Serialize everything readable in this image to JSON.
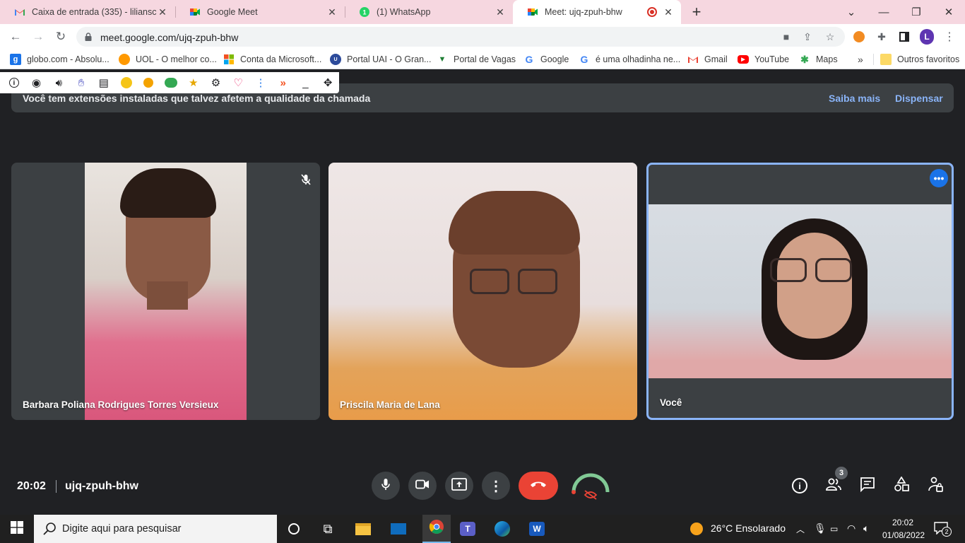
{
  "browser": {
    "tabs": [
      {
        "title": "Caixa de entrada (335) - lilianscar",
        "icon": "gmail-icon"
      },
      {
        "title": "Google Meet",
        "icon": "meet-icon"
      },
      {
        "title": "(1) WhatsApp",
        "icon": "whatsapp-icon"
      },
      {
        "title": "Meet: ujq-zpuh-bhw",
        "icon": "meet-icon",
        "active": true
      }
    ],
    "url": "meet.google.com/ujq-zpuh-bhw",
    "profile_initial": "L",
    "bookmarks": [
      "globo.com - Absolu...",
      "UOL - O melhor co...",
      "Conta da Microsoft...",
      "Portal UAI - O Gran...",
      "Portal de Vagas",
      "Google",
      "é uma olhadinha ne...",
      "Gmail",
      "YouTube",
      "Maps"
    ],
    "bookmarks_overflow": "»",
    "other_favorites": "Outros favoritos"
  },
  "meet": {
    "banner": {
      "message": "Você tem extensões instaladas que talvez afetem a qualidade da chamada",
      "learn_more": "Saiba mais",
      "dismiss": "Dispensar"
    },
    "participants": [
      {
        "name": "Barbara Poliana Rodrigues Torres Versieux",
        "muted": true
      },
      {
        "name": "Priscila Maria de Lana",
        "muted": false
      },
      {
        "name": "Você",
        "muted": false,
        "self": true
      }
    ],
    "time": "20:02",
    "meeting_code": "ujq-zpuh-bhw",
    "people_count": "3",
    "accent_color": "#8ab4f8",
    "hangup_color": "#ea4335"
  },
  "taskbar": {
    "search_placeholder": "Digite aqui para pesquisar",
    "weather": "26°C  Ensolarado",
    "time": "20:02",
    "date": "01/08/2022",
    "notifications": "2"
  }
}
